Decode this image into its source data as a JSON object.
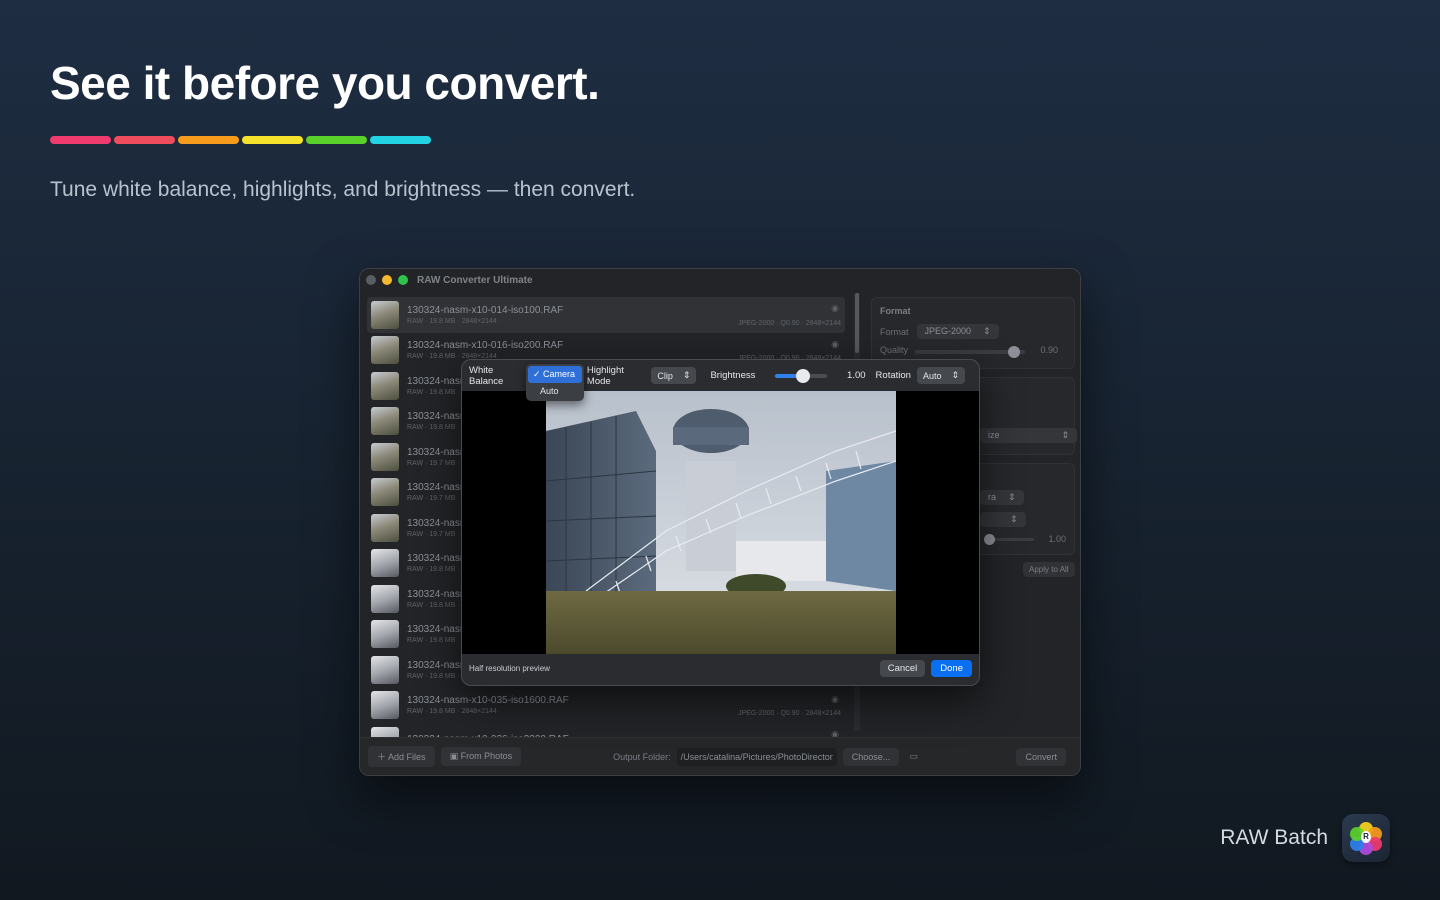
{
  "hero": {
    "title": "See it before you convert.",
    "subtitle": "Tune white balance, highlights, and brightness — then convert.",
    "bar_colors": [
      "#ef3b6e",
      "#ef4d5e",
      "#f79b1c",
      "#f7e22b",
      "#5ad12a",
      "#22d4e3"
    ]
  },
  "brand": {
    "name": "RAW Batch",
    "icon": "raw-batch-app-icon"
  },
  "window": {
    "title": "RAW Converter Ultimate",
    "files": [
      {
        "name": "130324-nasm-x10-014-iso100.RAF",
        "meta": "RAW · 19.8 MB · 2848×2144",
        "out": "JPEG-2000 · Q0.90 · 2848×2144"
      },
      {
        "name": "130324-nasm-x10-016-iso200.RAF",
        "meta": "RAW · 19.8 MB · 2848×2144",
        "out": "JPEG-2000 · Q0.90 · 2848×2144"
      },
      {
        "name": "130324-nasm",
        "meta": "RAW · 19.8 MB · 2",
        "out": ""
      },
      {
        "name": "130324-nasm",
        "meta": "RAW · 19.8 MB · 2",
        "out": ""
      },
      {
        "name": "130324-nasm",
        "meta": "RAW · 19.7 MB · 2",
        "out": ""
      },
      {
        "name": "130324-nasm",
        "meta": "RAW · 19.7 MB · 2",
        "out": ""
      },
      {
        "name": "130324-nasm",
        "meta": "RAW · 19.7 MB · 2",
        "out": ""
      },
      {
        "name": "130324-nasm",
        "meta": "RAW · 19.8 MB · 2",
        "out": ""
      },
      {
        "name": "130324-nasm",
        "meta": "RAW · 19.8 MB · 2",
        "out": ""
      },
      {
        "name": "130324-nasm",
        "meta": "RAW · 19.8 MB · 2",
        "out": ""
      },
      {
        "name": "130324-nasm",
        "meta": "RAW · 19.8 MB · 2",
        "out": ""
      },
      {
        "name": "130324-nasm-x10-035-iso1600.RAF",
        "meta": "RAW · 19.8 MB · 2848×2144",
        "out": "JPEG-2000 · Q0.90 · 2848×2144"
      },
      {
        "name": "130324-nasm-x10-036-iso3200.RAF",
        "meta": "",
        "out": ""
      }
    ],
    "sidebar": {
      "format_title": "Format",
      "format_label": "Format",
      "format_value": "JPEG-2000",
      "quality_label": "Quality",
      "quality_value": "0.90",
      "quality_fraction": 0.9,
      "size_partial": "ize",
      "ra_partial": "ra",
      "brightness_value": "1.00",
      "apply_all": "Apply to All"
    },
    "bottom": {
      "add_files": "Add Files",
      "from_photos": "From Photos",
      "output_label": "Output Folder:",
      "output_path": "/Users/catalina/Pictures/PhotoDirector",
      "choose": "Choose...",
      "convert": "Convert"
    }
  },
  "sheet": {
    "wb_label": "White Balance",
    "wb_options": [
      "✓ Camera",
      "Auto"
    ],
    "highlight_label": "Highlight Mode",
    "highlight_value": "Clip",
    "brightness_label": "Brightness",
    "brightness_value": "1.00",
    "brightness_fraction": 0.5,
    "rotation_label": "Rotation",
    "rotation_value": "Auto",
    "footer_note": "Half resolution preview",
    "cancel": "Cancel",
    "done": "Done"
  }
}
